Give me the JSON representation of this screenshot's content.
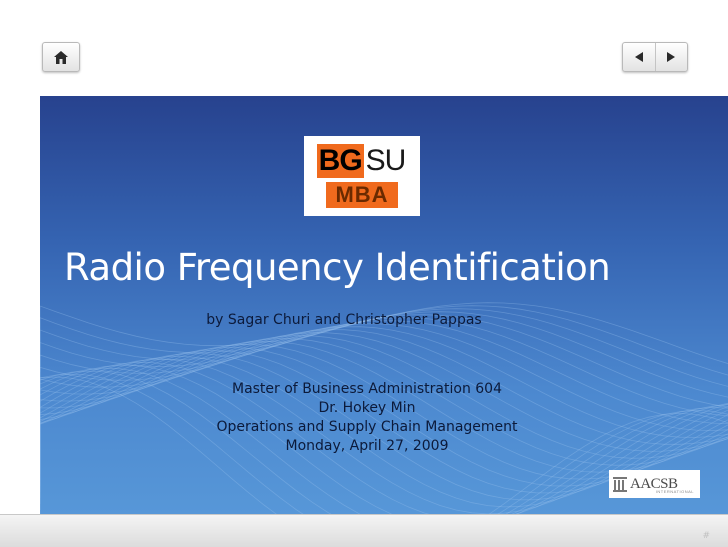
{
  "slide": {
    "title": "Radio Frequency Identification",
    "byline": "by Sagar Churi and Christopher Pappas",
    "course_lines": [
      "Master of Business Administration 604",
      "Dr. Hokey Min",
      "Operations and Supply Chain Management",
      "Monday, April 27, 2009"
    ],
    "slide_number": "#"
  },
  "logos": {
    "bgsu_part1": "BG",
    "bgsu_part2": "SU",
    "bgsu_program": "MBA",
    "aacsb_text": "AACSB",
    "aacsb_sub": "INTERNATIONAL"
  },
  "navigation": {
    "home_icon": "home-icon",
    "prev_icon": "triangle-left-icon",
    "next_icon": "triangle-right-icon"
  },
  "colors": {
    "panel_top": "#27428e",
    "panel_bottom": "#5797d8",
    "bgsu_orange": "#f06a1d",
    "text_dark": "#0c1a3a",
    "title_white": "#ffffff"
  }
}
